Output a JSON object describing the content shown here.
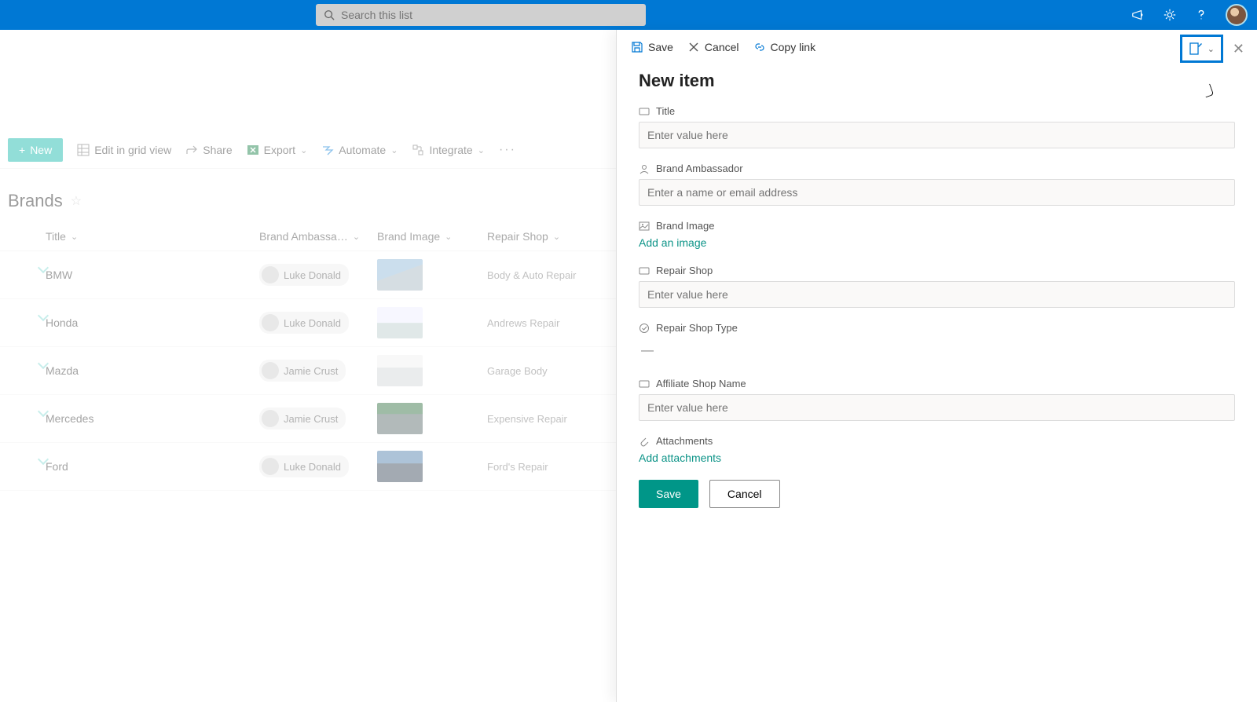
{
  "topbar": {
    "search_placeholder": "Search this list"
  },
  "toolbar": {
    "new": "New",
    "edit_grid": "Edit in grid view",
    "share": "Share",
    "export": "Export",
    "automate": "Automate",
    "integrate": "Integrate"
  },
  "list": {
    "title": "Brands",
    "columns": {
      "title": "Title",
      "ambassador": "Brand Ambassa…",
      "image": "Brand Image",
      "shop": "Repair Shop"
    },
    "rows": [
      {
        "title": "BMW",
        "ambassador": "Luke Donald",
        "shop": "Body & Auto Repair"
      },
      {
        "title": "Honda",
        "ambassador": "Luke Donald",
        "shop": "Andrews Repair"
      },
      {
        "title": "Mazda",
        "ambassador": "Jamie Crust",
        "shop": "Garage Body"
      },
      {
        "title": "Mercedes",
        "ambassador": "Jamie Crust",
        "shop": "Expensive Repair"
      },
      {
        "title": "Ford",
        "ambassador": "Luke Donald",
        "shop": "Ford's Repair"
      }
    ]
  },
  "panel": {
    "actions": {
      "save": "Save",
      "cancel": "Cancel",
      "copylink": "Copy link"
    },
    "title": "New item",
    "fields": {
      "title": {
        "label": "Title",
        "placeholder": "Enter value here"
      },
      "ambassador": {
        "label": "Brand Ambassador",
        "placeholder": "Enter a name or email address"
      },
      "image": {
        "label": "Brand Image",
        "action": "Add an image"
      },
      "shop": {
        "label": "Repair Shop",
        "placeholder": "Enter value here"
      },
      "shoptype": {
        "label": "Repair Shop Type",
        "value": "—"
      },
      "affiliate": {
        "label": "Affiliate Shop Name",
        "placeholder": "Enter value here"
      },
      "attachments": {
        "label": "Attachments",
        "action": "Add attachments"
      }
    },
    "buttons": {
      "save": "Save",
      "cancel": "Cancel"
    }
  }
}
